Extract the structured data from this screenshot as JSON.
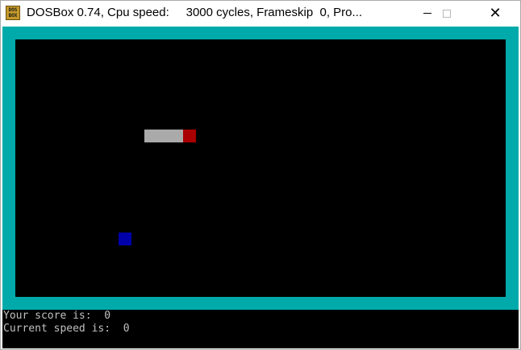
{
  "window": {
    "title": "DOSBox 0.74, Cpu speed:     3000 cycles, Frameskip  0, Pro..."
  },
  "colors": {
    "border": "#00aaaa",
    "snake_body": "#aaaaaa",
    "snake_head": "#aa0000",
    "food": "#0000aa",
    "background": "#000000",
    "text": "#c0c0c0"
  },
  "icons": {
    "app": "dosbox-icon",
    "minimize": "minimize-icon",
    "maximize": "maximize-icon",
    "close": "close-icon"
  },
  "game": {
    "score_line": "Your score is:  0",
    "speed_line": "Current speed is:  0"
  }
}
